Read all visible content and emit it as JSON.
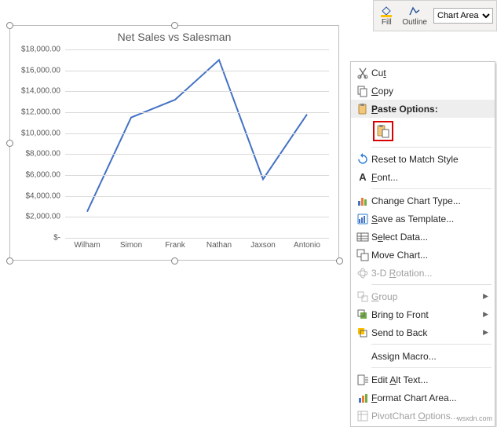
{
  "ribbon": {
    "fill_label": "Fill",
    "outline_label": "Outline",
    "element_selector": "Chart Area"
  },
  "chart_title": "Net Sales vs Salesman",
  "chart_data": {
    "type": "line",
    "categories": [
      "Wilham",
      "Simon",
      "Frank",
      "Nathan",
      "Jaxson",
      "Antonio"
    ],
    "values": [
      2500,
      11500,
      13200,
      17000,
      5600,
      11800
    ],
    "ylabel": "",
    "xlabel": "",
    "ylim": [
      0,
      18000
    ],
    "yticks": [
      "$-",
      "$2,000.00",
      "$4,000.00",
      "$6,000.00",
      "$8,000.00",
      "$10,000.00",
      "$12,000.00",
      "$14,000.00",
      "$16,000.00",
      "$18,000.00"
    ]
  },
  "context_menu": {
    "cut": "Cut",
    "copy": "Copy",
    "paste_options": "Paste Options:",
    "reset": "Reset to Match Style",
    "font": "Font...",
    "change_type": "Change Chart Type...",
    "save_template": "Save as Template...",
    "select_data": "Select Data...",
    "move_chart": "Move Chart...",
    "rotation3d": "3-D Rotation...",
    "group": "Group",
    "bring_front": "Bring to Front",
    "send_back": "Send to Back",
    "assign_macro": "Assign Macro...",
    "edit_alt": "Edit Alt Text...",
    "format_area": "Format Chart Area...",
    "pivot_options": "PivotChart Options..."
  },
  "watermark": "wsxdn.com"
}
